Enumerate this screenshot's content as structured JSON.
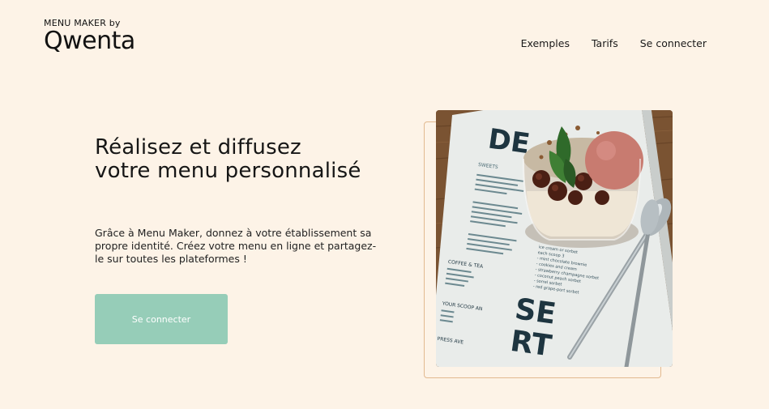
{
  "brand": {
    "tagline": "MENU MAKER by",
    "name": "Qwenta"
  },
  "nav": {
    "items": [
      {
        "label": "Exemples"
      },
      {
        "label": "Tarifs"
      },
      {
        "label": "Se connecter"
      }
    ]
  },
  "hero": {
    "title": "Réalisez et diffusez votre menu personnalisé",
    "text": "Grâce à Menu Maker, donnez à votre établissement sa propre identité. Créez votre menu en ligne et partagez-le sur toutes les plateformes !",
    "cta_label": "Se connecter"
  },
  "image": {
    "menu_word_top": "DE",
    "menu_word_bottom_1": "SE",
    "menu_word_bottom_2": "RT",
    "section_sweets": "SWEETS",
    "section_coffee": "COFFEE & TEA",
    "section_scoop": "YOUR SCOOP AN",
    "section_press": "PRESS AVE",
    "menu_lines": [
      "ice cream or sorbet",
      "each scoop   3",
      "- mint chocolate brownie",
      "- cookies and cream",
      "- strawberry champagne sorbet",
      "- coconut peach sorbet",
      "- sorrel sorbet",
      "- red grape-port sorbet"
    ]
  },
  "colors": {
    "background": "#fdf3e7",
    "accent": "#96cdb8",
    "outline": "#e2b98f"
  }
}
